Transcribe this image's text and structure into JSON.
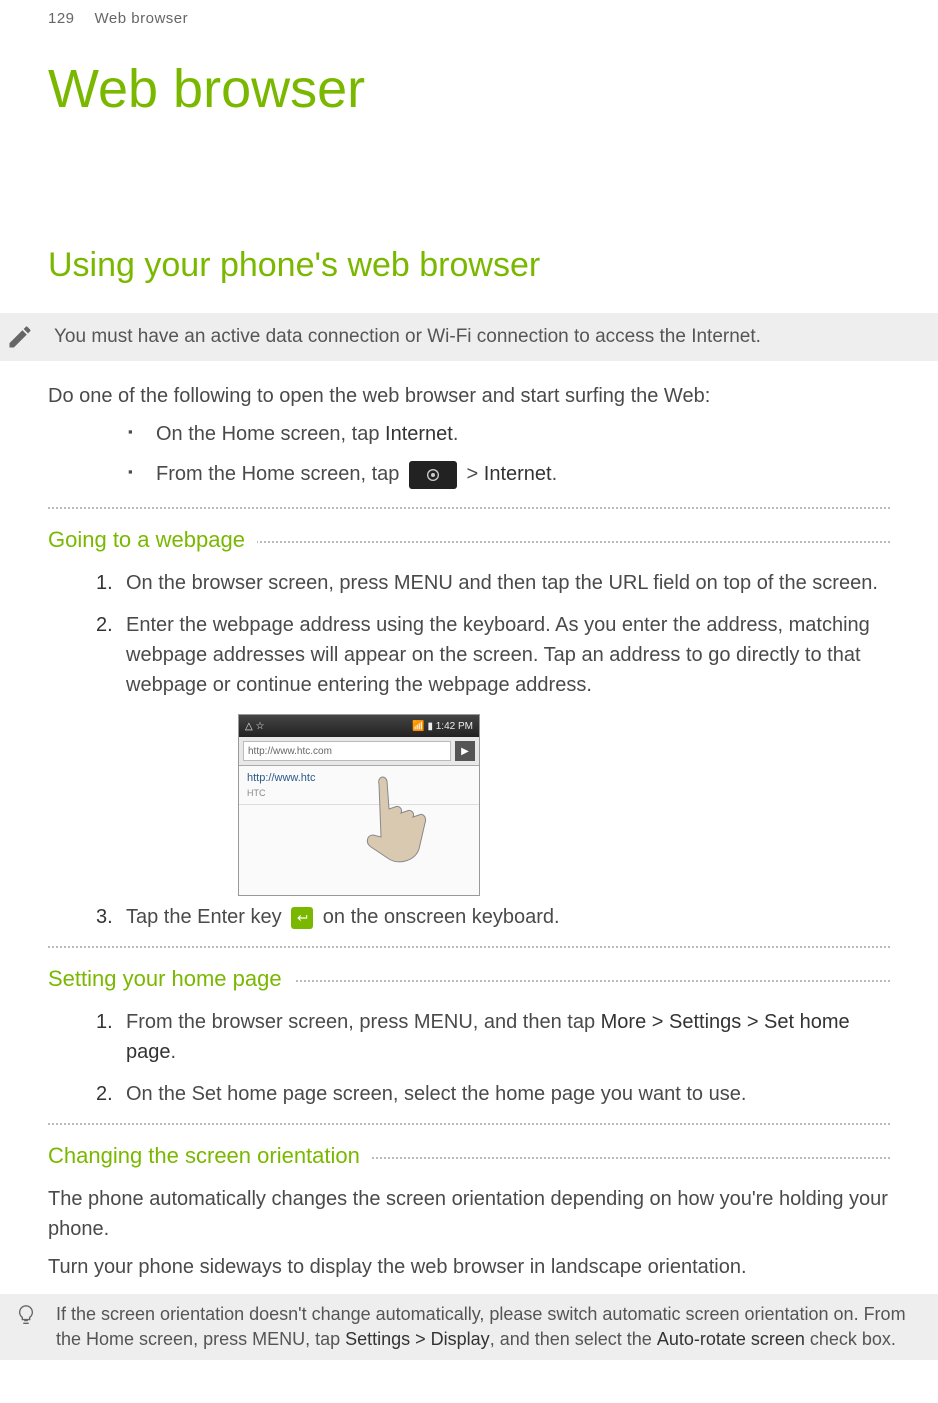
{
  "header": {
    "page_num": "129",
    "running": "Web browser"
  },
  "chapter_title": "Web browser",
  "section_title": "Using your phone's web browser",
  "note": "You must have an active data connection or Wi-Fi connection to access the Internet.",
  "intro": "Do one of the following to open the web browser and start surfing the Web:",
  "bullets": {
    "b1_pre": "On the Home screen, tap ",
    "b1_bold": "Internet",
    "b1_post": ".",
    "b2_pre": "From the Home screen, tap ",
    "b2_gt": " > ",
    "b2_bold": "Internet",
    "b2_post": "."
  },
  "sub1": {
    "title": "Going to a webpage",
    "s1": "On the browser screen, press MENU and then tap the URL field on top of the screen.",
    "s2": "Enter the webpage address using the keyboard. As you enter the address, matching webpage addresses will appear on the screen. Tap an address to go directly to that webpage or continue entering the webpage address.",
    "s3_pre": "Tap the Enter key ",
    "s3_post": " on the onscreen keyboard."
  },
  "screenshot": {
    "status_left": "△ ☆",
    "status_right": "📶 ▮ 1:42 PM",
    "url_text": "http://www.htc.com",
    "suggest_main": "http://www.htc",
    "suggest_sub": "HTC"
  },
  "sub2": {
    "title": "Setting your home page",
    "s1_pre": "From the browser screen, press MENU, and then tap ",
    "s1_bold": "More > Settings > Set home page",
    "s1_post": ".",
    "s2": "On the Set home page screen, select the home page you want to use."
  },
  "sub3": {
    "title": "Changing the screen orientation",
    "p1": "The phone automatically changes the screen orientation depending on how you're holding your phone.",
    "p2": "Turn your phone sideways to display the web browser in landscape orientation."
  },
  "tip": {
    "pre": "If the screen orientation doesn't change automatically, please switch automatic screen orientation on. From the Home screen, press MENU, tap ",
    "bold1": "Settings > Display",
    "mid": ", and then select the ",
    "bold2": "Auto-rotate screen",
    "post": " check box."
  }
}
